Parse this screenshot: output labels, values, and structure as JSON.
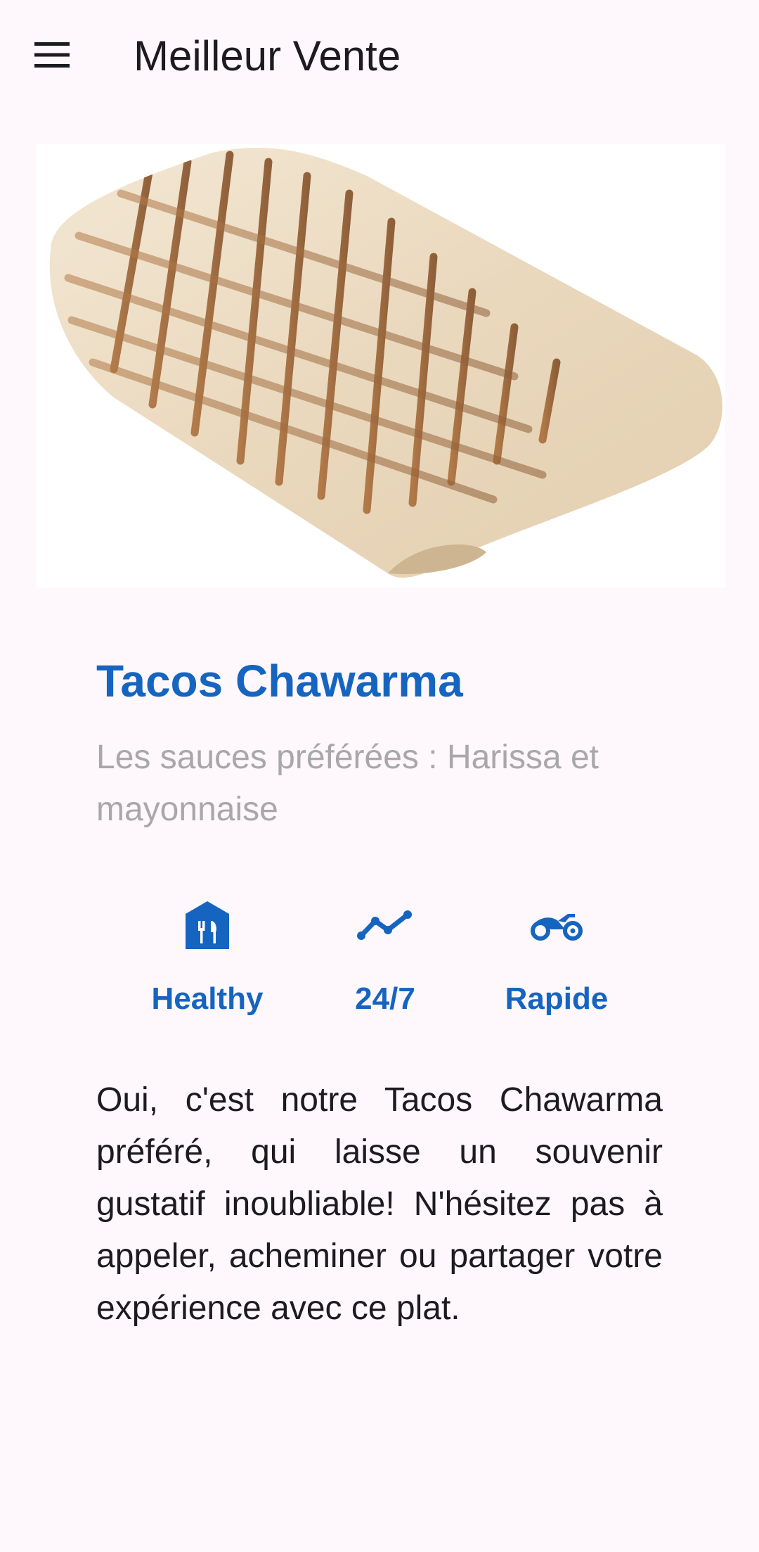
{
  "app_bar": {
    "title": "Meilleur Vente",
    "menu_icon": "menu-icon"
  },
  "product": {
    "name": "Tacos Chawarma",
    "subtitle": "Les sauces préférées : Harissa et mayonnaise",
    "image": "grilled-tacos-image"
  },
  "features": [
    {
      "icon": "restaurant-icon",
      "label": "Healthy"
    },
    {
      "icon": "trending-line-icon",
      "label": "24/7"
    },
    {
      "icon": "motorcycle-icon",
      "label": "Rapide"
    }
  ],
  "description": "Oui, c'est notre Tacos Chawarma préféré, qui laisse un souvenir gustatif inoubliable! N'hésitez pas à appeler, acheminer ou partager votre expérience avec ce plat.",
  "colors": {
    "accent": "#1565c0",
    "background": "#fef7fb",
    "subtitle": "#a8a8a8",
    "text": "#1c1b1f"
  }
}
